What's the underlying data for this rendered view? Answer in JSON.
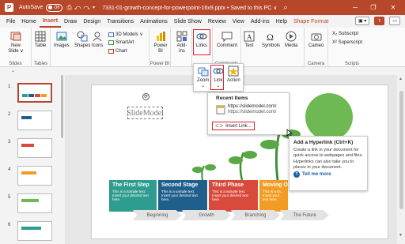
{
  "titlebar": {
    "logo": "P",
    "autosave": "AutoSave",
    "autosave_state": "Off",
    "filename": "7331-01-growth-concept-for-powerpoint-16x9.pptx",
    "save_status": "• Saved to this PC ∨"
  },
  "tabs": [
    "File",
    "Home",
    "Insert",
    "Draw",
    "Design",
    "Transitions",
    "Animations",
    "Slide Show",
    "Review",
    "View",
    "Add-ins",
    "Help",
    "Shape Format"
  ],
  "active_tab": "Insert",
  "ribbon": {
    "new_slide": "New Slide ∨",
    "slides_label": "Slides",
    "table": "Table",
    "tables_label": "Tables",
    "images": "Images",
    "shapes": "Shapes",
    "icons": "Icons",
    "models3d": "3D Models ∨",
    "smartart": "SmartArt",
    "chart": "Chart",
    "power_bi": "Power BI",
    "power_bi_label": "Power BI",
    "addins": "Add-ins",
    "links": "Links",
    "comment": "Comment",
    "comments_label": "Comments",
    "text": "Text",
    "symbols": "Symbols",
    "media": "Media",
    "cameo": "Cameo",
    "camera_label": "Camera",
    "subscript": "X₂ Subscript",
    "superscript": "X² Superscript",
    "scripts_label": "Scripts"
  },
  "links_panel": {
    "zoom": "Zoom",
    "link": "Link",
    "action": "Action"
  },
  "recent_items": {
    "header": "Recent Items",
    "url_main": "https://slidemodel.com/",
    "url_sub": "https://slidemodel.com/",
    "insert_link": "Insert Link..."
  },
  "tooltip": {
    "title": "Add a Hyperlink (Ctrl+K)",
    "body1": "Create a link in your document for quick access to webpages and files.",
    "body2": "Hyperlinks can also take you to places in your document.",
    "more": "Tell me more"
  },
  "slide": {
    "textbox": "SlideModel",
    "steps": [
      {
        "title": "The First Step",
        "body": "This is a sample text. Insert your desired text here.",
        "color": "#2e9c8f"
      },
      {
        "title": "Second Stage",
        "body": "This is a sample text. Insert your desired text here.",
        "color": "#1f5f8b"
      },
      {
        "title": "Third Phase",
        "body": "This is a sample text. Insert your desired text here.",
        "color": "#d94a3d"
      },
      {
        "title": "Moving O...",
        "body": "This is a sa... Insert your... text here.",
        "color": "#f29c24"
      }
    ],
    "timeline": [
      "Beginning",
      "Growth",
      "Branching",
      "The Future"
    ]
  },
  "thumbnails": [
    "1",
    "2",
    "3",
    "4",
    "5",
    "6"
  ],
  "colors": {
    "accent": "#b7472a",
    "highlight": "#d9232d"
  }
}
